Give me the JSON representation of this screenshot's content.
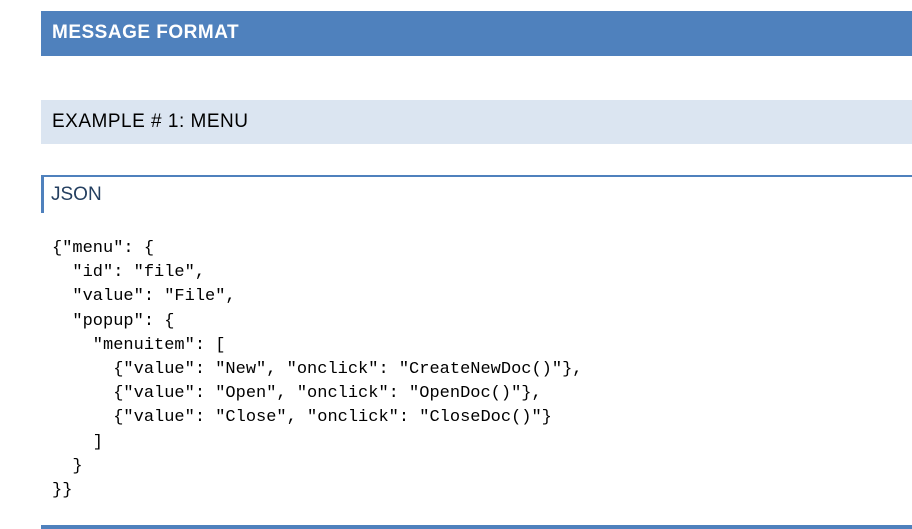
{
  "heading1": "MESSAGE FORMAT",
  "heading2": "EXAMPLE # 1: MENU",
  "heading3": "JSON",
  "code_lines": [
    "{\"menu\": {",
    "  \"id\": \"file\",",
    "  \"value\": \"File\",",
    "  \"popup\": {",
    "    \"menuitem\": [",
    "      {\"value\": \"New\", \"onclick\": \"CreateNewDoc()\"},",
    "      {\"value\": \"Open\", \"onclick\": \"OpenDoc()\"},",
    "      {\"value\": \"Close\", \"onclick\": \"CloseDoc()\"}",
    "    ]",
    "  }",
    "}}"
  ],
  "colors": {
    "heading1_bg": "#4f81bd",
    "heading2_bg": "#dbe5f1",
    "heading3_text": "#243f60",
    "accent_border": "#4f81bd"
  }
}
